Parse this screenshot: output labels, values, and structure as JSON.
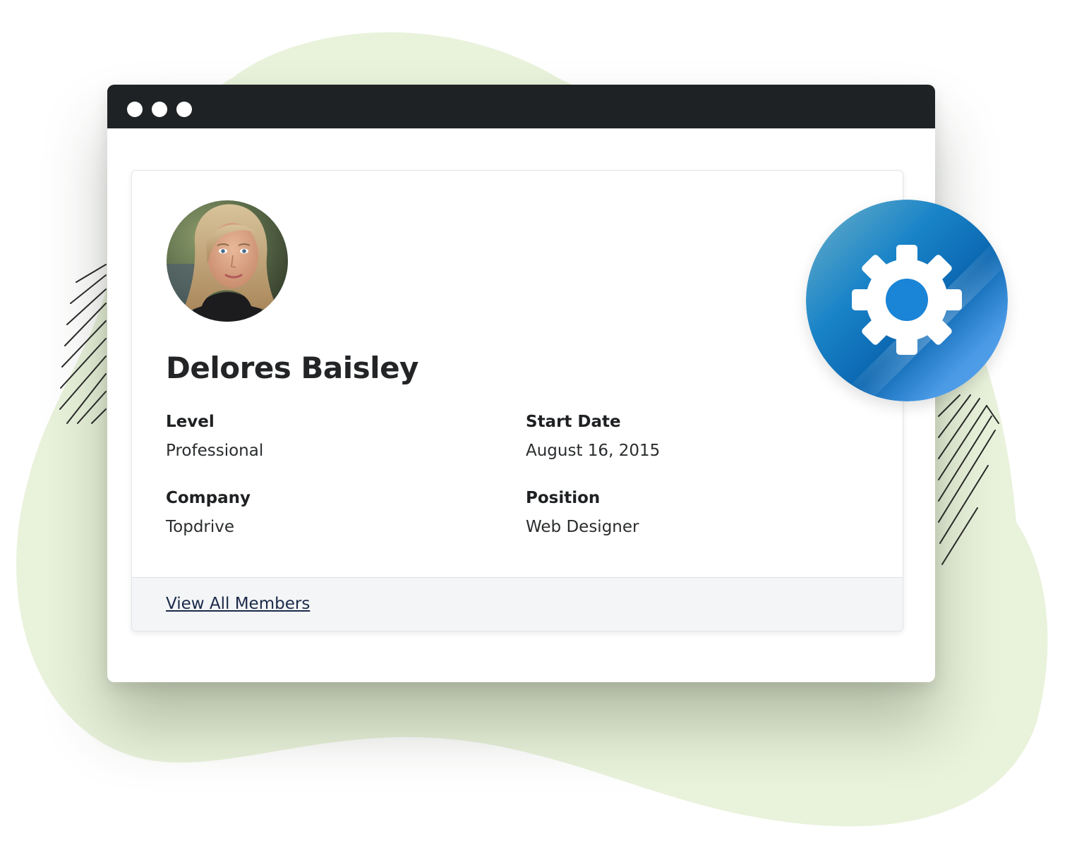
{
  "window": {
    "controls": [
      "dot",
      "dot",
      "dot"
    ]
  },
  "member": {
    "name": "Delores Baisley",
    "avatar_icon": "member-photo",
    "fields": [
      {
        "label": "Level",
        "value": "Professional"
      },
      {
        "label": "Start Date",
        "value": "August 16, 2015"
      },
      {
        "label": "Company",
        "value": "Topdrive"
      },
      {
        "label": "Position",
        "value": "Web Designer"
      }
    ]
  },
  "footer": {
    "link_label": "View All Members"
  },
  "badge": {
    "icon": "gear-icon"
  },
  "colors": {
    "blob": "#e9f2db",
    "titlebar": "#1f2225",
    "badge_blue": "#2f8be0",
    "link": "#1b2a4a"
  }
}
